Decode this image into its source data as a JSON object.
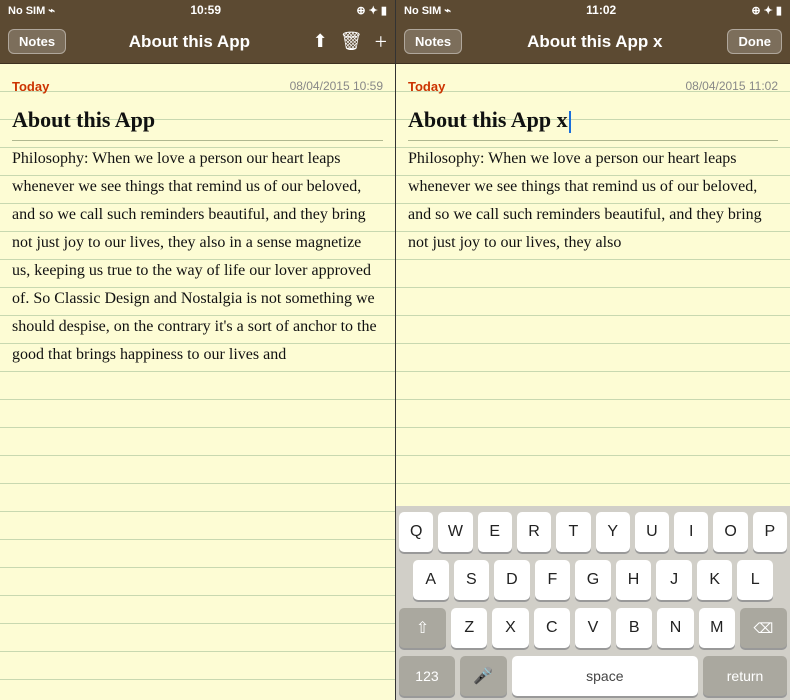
{
  "panel1": {
    "statusBar": {
      "left": "No SIM ⌁",
      "time": "10:59",
      "right": "⊕ ✦ ▮"
    },
    "navBar": {
      "backLabel": "Notes",
      "title": "About this App",
      "icons": [
        "share",
        "trash",
        "add"
      ]
    },
    "note": {
      "dateLabel": "Today",
      "timestamp": "08/04/2015 10:59",
      "title": "About this App",
      "body": "Philosophy: When we love a person our heart leaps whenever we see things that remind us of our beloved, and so we call such reminders beautiful, and they bring not just joy to our lives, they also in a sense magnetize us, keeping us true to the way of life our lover approved of. So Classic Design and Nostalgia is not something we should despise, on the contrary it's a sort of anchor to the good that brings happiness to our lives and"
    }
  },
  "panel2": {
    "statusBar": {
      "left": "No SIM ⌁",
      "time": "11:02",
      "right": "⊕ ✦ ▮"
    },
    "navBar": {
      "backLabel": "Notes",
      "title": "About this App x",
      "doneLabel": "Done"
    },
    "note": {
      "dateLabel": "Today",
      "timestamp": "08/04/2015 11:02",
      "title": "About this App x",
      "body": "Philosophy: When we love a person our heart leaps whenever we see things that remind us of our beloved, and so we call such reminders beautiful, and they bring not just joy to our lives, they also"
    },
    "keyboard": {
      "rows": [
        [
          "Q",
          "W",
          "E",
          "R",
          "T",
          "Y",
          "U",
          "I",
          "O",
          "P"
        ],
        [
          "A",
          "S",
          "D",
          "F",
          "G",
          "H",
          "J",
          "K",
          "L"
        ],
        [
          "⇧",
          "Z",
          "X",
          "C",
          "V",
          "B",
          "N",
          "M",
          "⌫"
        ],
        [
          "123",
          "🎤",
          "space",
          "return"
        ]
      ]
    }
  }
}
